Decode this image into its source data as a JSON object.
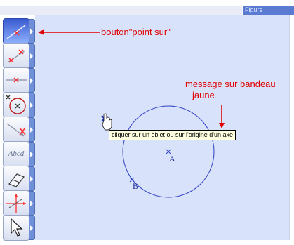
{
  "window": {
    "title_fragment": "Figure"
  },
  "toolbar": {
    "tools": [
      {
        "name": "point-on-object-tool",
        "icon": "point-on-line-icon",
        "active": true
      },
      {
        "name": "segment-point-tool",
        "icon": "segment-point-icon",
        "active": false
      },
      {
        "name": "line-tool",
        "icon": "line-icon",
        "active": false
      },
      {
        "name": "circle-tool",
        "icon": "circle-icon",
        "active": false
      },
      {
        "name": "vector-tool",
        "icon": "vector-icon",
        "active": false
      },
      {
        "name": "text-tool",
        "icon": "text-icon",
        "label": "Abcd",
        "active": false
      },
      {
        "name": "eraser-tool",
        "icon": "eraser-icon",
        "active": false
      },
      {
        "name": "axes-tool",
        "icon": "axes-icon",
        "active": false
      },
      {
        "name": "color-tool",
        "icon": "color-palette-icon",
        "active": false
      },
      {
        "name": "pointer-tool",
        "icon": "pointer-arrow-icon",
        "active": false
      }
    ]
  },
  "annotations": {
    "button_note": "bouton\"point sur\"",
    "message_note_line1": "message sur bandeau",
    "message_note_line2": "jaune",
    "color": "#e00000"
  },
  "tooltip": {
    "text": "cliquer sur un objet ou sur l'origine d'un axe"
  },
  "figure": {
    "points": [
      {
        "label": "A"
      },
      {
        "label": "B"
      }
    ],
    "stroke_color": "#2d3fc4"
  }
}
